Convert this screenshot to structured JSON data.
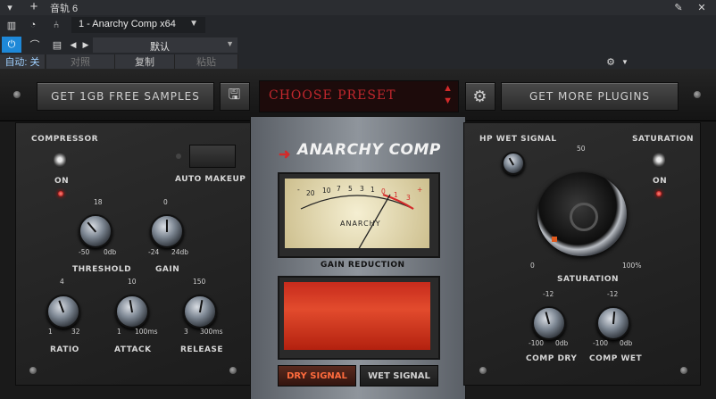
{
  "host": {
    "track_title": "音轨 6",
    "add_symbol": "+",
    "plugin_instance": "1 - Anarchy Comp x64",
    "preset_default": "默认",
    "auto_label": "自动: 关",
    "compare_label": "对照",
    "copy_label": "复制",
    "paste_label": "粘贴"
  },
  "plugin": {
    "free_samples_button": "GET 1GB FREE SAMPLES",
    "preset_placeholder": "CHOOSE PRESET",
    "more_plugins_button": "GET MORE PLUGINS",
    "logo": "ANARCHY COMP",
    "compressor": {
      "label": "COMPRESSOR",
      "state": "ON",
      "auto_makeup": "AUTO MAKEUP",
      "threshold": {
        "label": "THRESHOLD",
        "max": "18",
        "min": "-50",
        "unit": "0db"
      },
      "gain": {
        "label": "GAIN",
        "max": "0",
        "min": "-24",
        "unit": "24db"
      },
      "ratio": {
        "label": "RATIO",
        "max": "4",
        "min": "1",
        "unit": "32"
      },
      "attack": {
        "label": "ATTACK",
        "max": "10",
        "min": "1",
        "unit": "100ms"
      },
      "release": {
        "label": "RELEASE",
        "max": "150",
        "min": "3",
        "unit": "300ms"
      }
    },
    "meter": {
      "label": "GAIN REDUCTION",
      "scale": [
        "20",
        "10",
        "7",
        "5",
        "3",
        "1",
        "0",
        "1",
        "3"
      ],
      "minus": "-",
      "plus": "+",
      "brand": "ANARCHY"
    },
    "dry_signal": "DRY SIGNAL",
    "wet_signal": "WET SIGNAL",
    "right": {
      "hp_wet": "HP WET SIGNAL",
      "saturation_toggle": "SATURATION",
      "saturation_state": "ON",
      "saturation_knob": {
        "label": "SATURATION",
        "top": "50",
        "min": "0",
        "max": "100%"
      },
      "comp_dry": {
        "label": "COMP DRY",
        "top": "-12",
        "min": "-100",
        "unit": "0db"
      },
      "comp_wet": {
        "label": "COMP WET",
        "top": "-12",
        "min": "-100",
        "unit": "0db"
      }
    }
  },
  "colors": {
    "accent_red": "#c2272d",
    "host_blue": "#1e88d8"
  }
}
